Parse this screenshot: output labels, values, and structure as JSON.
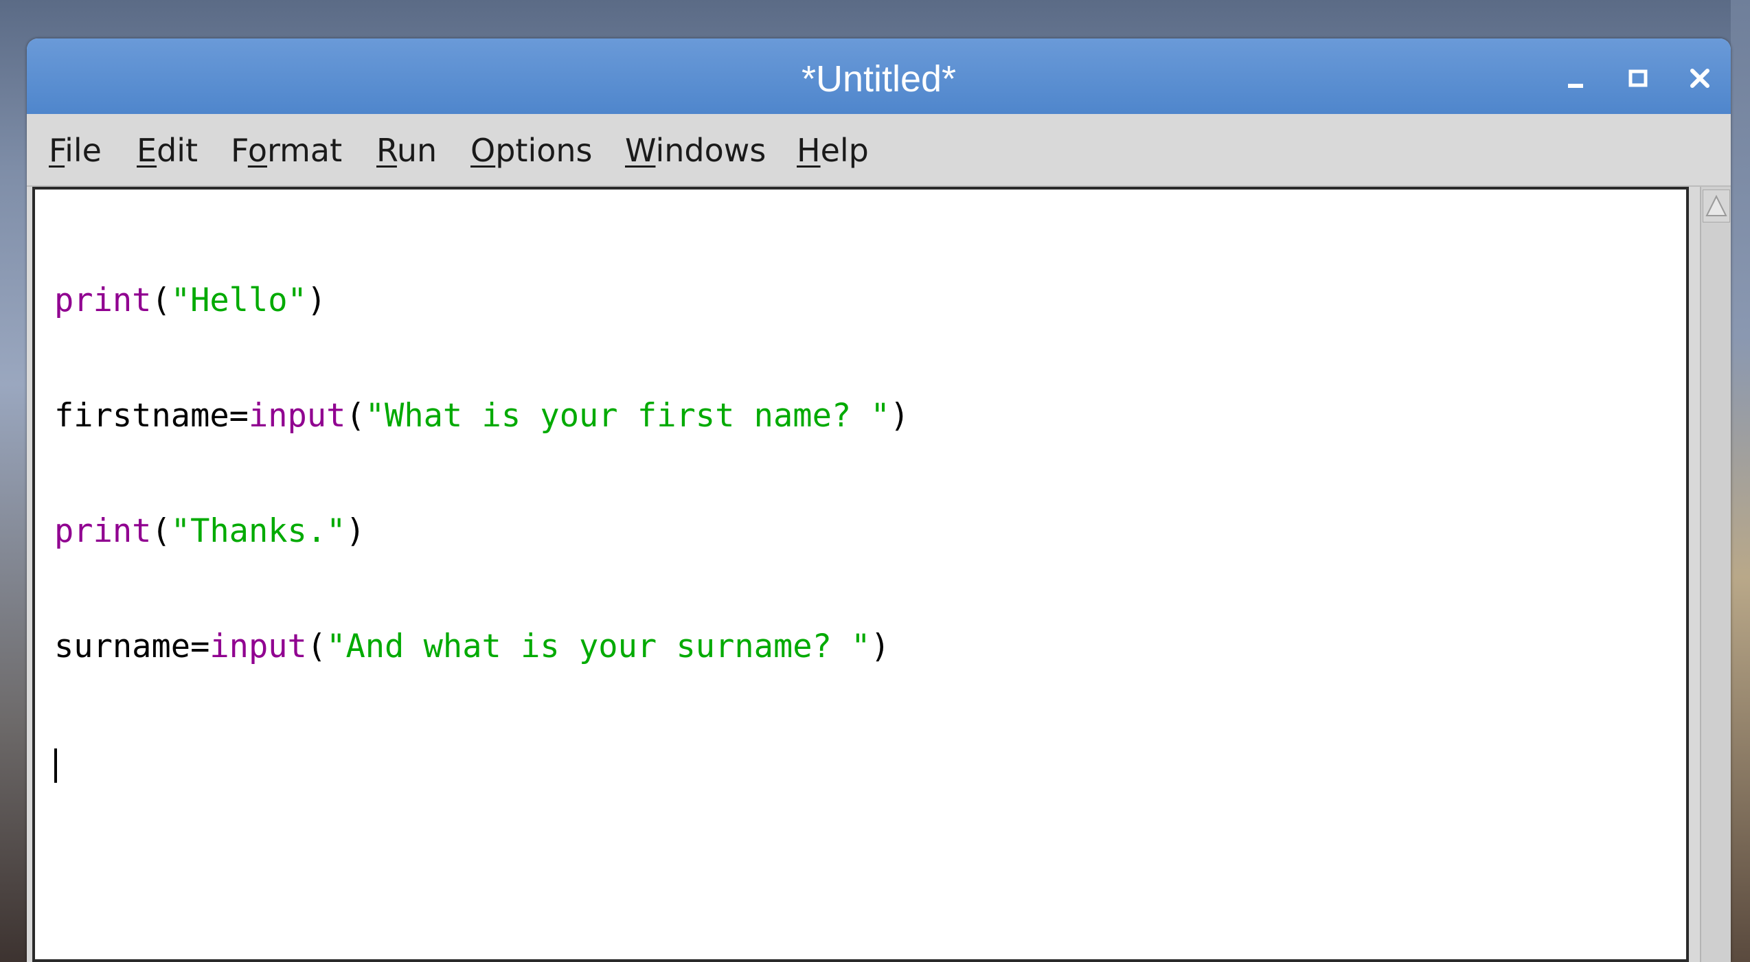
{
  "window": {
    "title": "*Untitled*"
  },
  "menu": [
    {
      "pre": "",
      "u": "F",
      "post": "ile"
    },
    {
      "pre": "",
      "u": "E",
      "post": "dit"
    },
    {
      "pre": "F",
      "u": "o",
      "post": "rmat"
    },
    {
      "pre": "",
      "u": "R",
      "post": "un"
    },
    {
      "pre": "",
      "u": "O",
      "post": "ptions"
    },
    {
      "pre": "",
      "u": "W",
      "post": "indows"
    },
    {
      "pre": "",
      "u": "H",
      "post": "elp"
    }
  ],
  "editor": {
    "lines": [
      [
        {
          "t": "print",
          "c": "kw"
        },
        {
          "t": "(",
          "c": ""
        },
        {
          "t": "\"Hello\"",
          "c": "str"
        },
        {
          "t": ")",
          "c": ""
        }
      ],
      [
        {
          "t": "firstname=",
          "c": ""
        },
        {
          "t": "input",
          "c": "kw"
        },
        {
          "t": "(",
          "c": ""
        },
        {
          "t": "\"What is your first name? \"",
          "c": "str"
        },
        {
          "t": ")",
          "c": ""
        }
      ],
      [
        {
          "t": "print",
          "c": "kw"
        },
        {
          "t": "(",
          "c": ""
        },
        {
          "t": "\"Thanks.\"",
          "c": "str"
        },
        {
          "t": ")",
          "c": ""
        }
      ],
      [
        {
          "t": "surname=",
          "c": ""
        },
        {
          "t": "input",
          "c": "kw"
        },
        {
          "t": "(",
          "c": ""
        },
        {
          "t": "\"And what is your surname? \"",
          "c": "str"
        },
        {
          "t": ")",
          "c": ""
        }
      ]
    ]
  },
  "colors": {
    "titlebar": "#5a8fd2",
    "keyword": "#900090",
    "string": "#00aa00"
  },
  "icons": {
    "minimize": "minimize-icon",
    "maximize": "maximize-icon",
    "close": "close-icon",
    "scroll_up": "scroll-up-arrow-icon"
  }
}
